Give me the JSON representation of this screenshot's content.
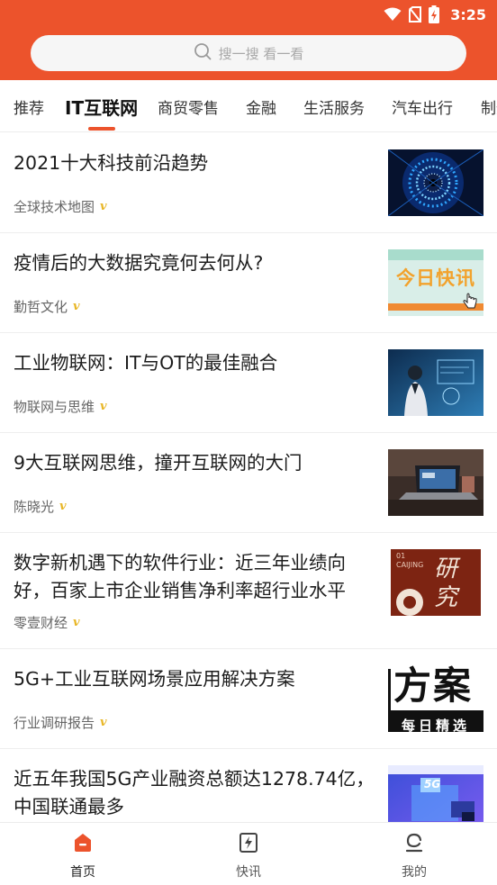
{
  "status_bar": {
    "time": "3:25"
  },
  "search": {
    "placeholder": "搜一搜 看一看"
  },
  "tabs": [
    {
      "label": "推荐",
      "active": false
    },
    {
      "label": "IT互联网",
      "active": true
    },
    {
      "label": "商贸零售",
      "active": false
    },
    {
      "label": "金融",
      "active": false
    },
    {
      "label": "生活服务",
      "active": false
    },
    {
      "label": "汽车出行",
      "active": false
    },
    {
      "label": "制造",
      "active": false
    }
  ],
  "feed": [
    {
      "title": "2021十大科技前沿趋势",
      "source": "全球技术地图",
      "verified": "v"
    },
    {
      "title": "疫情后的大数据究竟何去何从?",
      "source": "勤哲文化",
      "verified": "v",
      "thumb_text": "今日快讯"
    },
    {
      "title": "工业物联网：IT与OT的最佳融合",
      "source": "物联网与思维",
      "verified": "v"
    },
    {
      "title": "9大互联网思维，撞开互联网的大门",
      "source": "陈晓光",
      "verified": "v"
    },
    {
      "title": "数字新机遇下的软件行业：近三年业绩向好，百家上市企业销售净利率超行业水平",
      "source": "零壹财经",
      "verified": "v",
      "thumb_text_top": "01 CAIJING",
      "thumb_text": "研究"
    },
    {
      "title": "5G+工业互联网场景应用解决方案",
      "source": "行业调研报告",
      "verified": "v",
      "thumb_text": "方案",
      "thumb_text_sub": "每日精选"
    },
    {
      "title": "近五年我国5G产业融资总额达1278.74亿，中国联通最多",
      "source": "",
      "verified": "",
      "thumb_text": "5G"
    }
  ],
  "bottom_nav": [
    {
      "label": "首页",
      "icon": "home-icon",
      "active": true
    },
    {
      "label": "快讯",
      "icon": "flash-news-icon",
      "active": false
    },
    {
      "label": "我的",
      "icon": "profile-icon",
      "active": false
    }
  ],
  "colors": {
    "brand": "#ec532c",
    "verified": "#e8b626"
  }
}
